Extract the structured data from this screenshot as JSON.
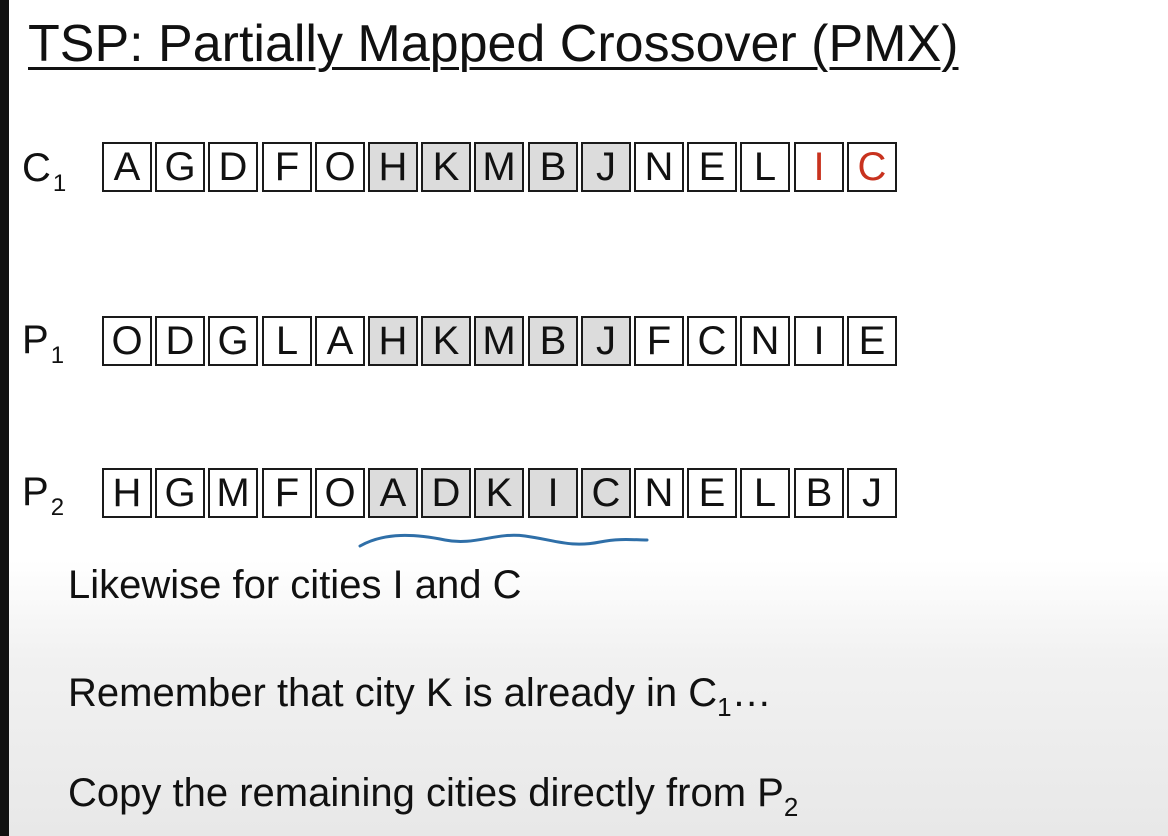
{
  "title": "TSP: Partially Mapped Crossover (PMX)",
  "rows": [
    {
      "label": "C",
      "sub": "1",
      "cells": [
        {
          "t": "A",
          "shaded": false,
          "red": false
        },
        {
          "t": "G",
          "shaded": false,
          "red": false
        },
        {
          "t": "D",
          "shaded": false,
          "red": false
        },
        {
          "t": "F",
          "shaded": false,
          "red": false
        },
        {
          "t": "O",
          "shaded": false,
          "red": false
        },
        {
          "t": "H",
          "shaded": true,
          "red": false
        },
        {
          "t": "K",
          "shaded": true,
          "red": false
        },
        {
          "t": "M",
          "shaded": true,
          "red": false
        },
        {
          "t": "B",
          "shaded": true,
          "red": false
        },
        {
          "t": "J",
          "shaded": true,
          "red": false
        },
        {
          "t": "N",
          "shaded": false,
          "red": false
        },
        {
          "t": "E",
          "shaded": false,
          "red": false
        },
        {
          "t": "L",
          "shaded": false,
          "red": false
        },
        {
          "t": "I",
          "shaded": false,
          "red": true
        },
        {
          "t": "C",
          "shaded": false,
          "red": true
        }
      ]
    },
    {
      "label": "P",
      "sub": "1",
      "cells": [
        {
          "t": "O",
          "shaded": false,
          "red": false
        },
        {
          "t": "D",
          "shaded": false,
          "red": false
        },
        {
          "t": "G",
          "shaded": false,
          "red": false
        },
        {
          "t": "L",
          "shaded": false,
          "red": false
        },
        {
          "t": "A",
          "shaded": false,
          "red": false
        },
        {
          "t": "H",
          "shaded": true,
          "red": false
        },
        {
          "t": "K",
          "shaded": true,
          "red": false
        },
        {
          "t": "M",
          "shaded": true,
          "red": false
        },
        {
          "t": "B",
          "shaded": true,
          "red": false
        },
        {
          "t": "J",
          "shaded": true,
          "red": false
        },
        {
          "t": "F",
          "shaded": false,
          "red": false
        },
        {
          "t": "C",
          "shaded": false,
          "red": false
        },
        {
          "t": "N",
          "shaded": false,
          "red": false
        },
        {
          "t": "I",
          "shaded": false,
          "red": false
        },
        {
          "t": "E",
          "shaded": false,
          "red": false
        }
      ]
    },
    {
      "label": "P",
      "sub": "2",
      "cells": [
        {
          "t": "H",
          "shaded": false,
          "red": false
        },
        {
          "t": "G",
          "shaded": false,
          "red": false
        },
        {
          "t": "M",
          "shaded": false,
          "red": false
        },
        {
          "t": "F",
          "shaded": false,
          "red": false
        },
        {
          "t": "O",
          "shaded": false,
          "red": false
        },
        {
          "t": "A",
          "shaded": true,
          "red": false
        },
        {
          "t": "D",
          "shaded": true,
          "red": false
        },
        {
          "t": "K",
          "shaded": true,
          "red": false
        },
        {
          "t": "I",
          "shaded": true,
          "red": false
        },
        {
          "t": "C",
          "shaded": true,
          "red": false
        },
        {
          "t": "N",
          "shaded": false,
          "red": false
        },
        {
          "t": "E",
          "shaded": false,
          "red": false
        },
        {
          "t": "L",
          "shaded": false,
          "red": false
        },
        {
          "t": "B",
          "shaded": false,
          "red": false
        },
        {
          "t": "J",
          "shaded": false,
          "red": false
        }
      ]
    }
  ],
  "notes": {
    "n1": "Likewise for cities I and C",
    "n2_main": "Remember that city K is already in C",
    "n2_sub": "1",
    "n2_tail": "…",
    "n3_main": "Copy the remaining cities directly from P",
    "n3_sub": "2"
  },
  "colors": {
    "shaded": "#dcdcdc",
    "highlight_text": "#c8321e",
    "squiggle": "#2f6fa8"
  }
}
